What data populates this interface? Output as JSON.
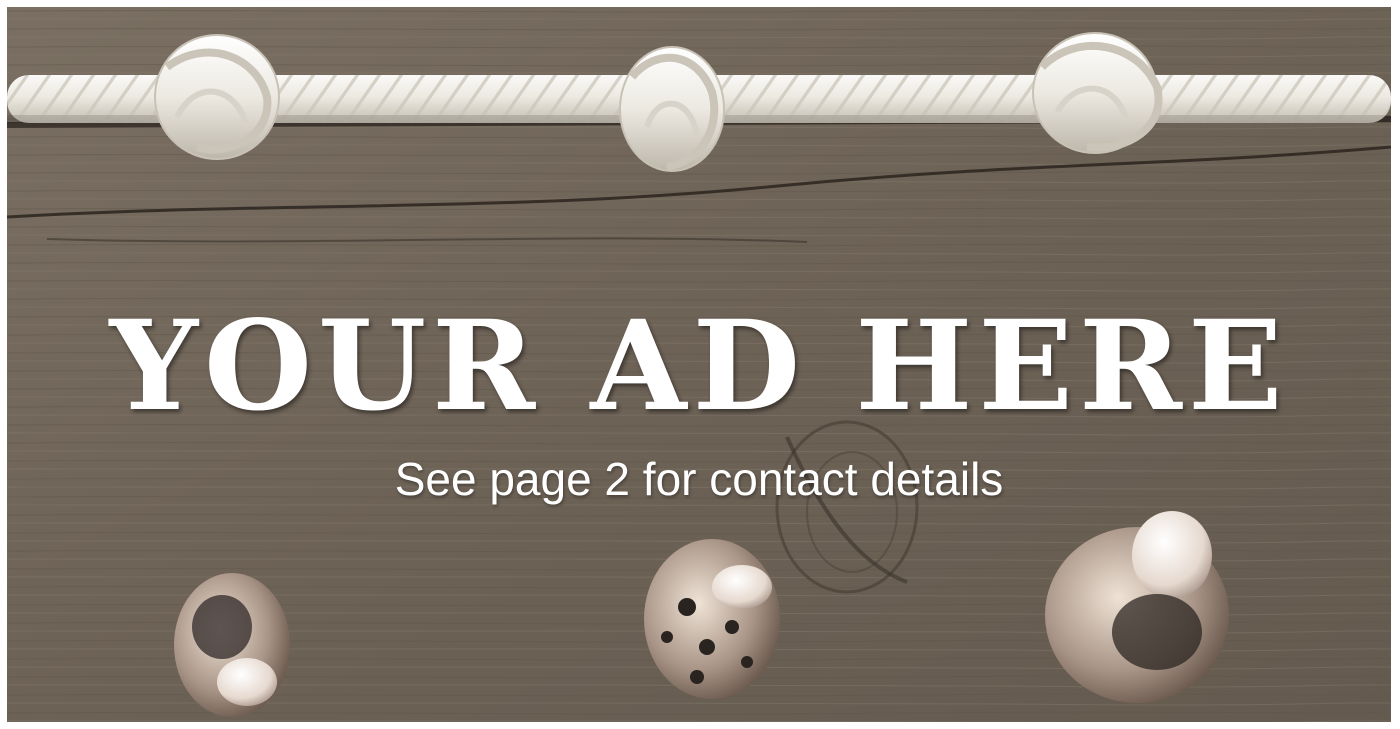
{
  "ad": {
    "headline": "YOUR AD HERE",
    "subline": "See page 2 for contact details"
  },
  "colors": {
    "wood": "#6f6457",
    "wood_light": "#8a7f71",
    "wood_dark": "#4e463d",
    "rope": "#eceae2",
    "rope_shadow": "#b9b4a8",
    "text": "#ffffff"
  },
  "icons": [
    "rope-icon",
    "knot-icon",
    "seashell-icon"
  ]
}
